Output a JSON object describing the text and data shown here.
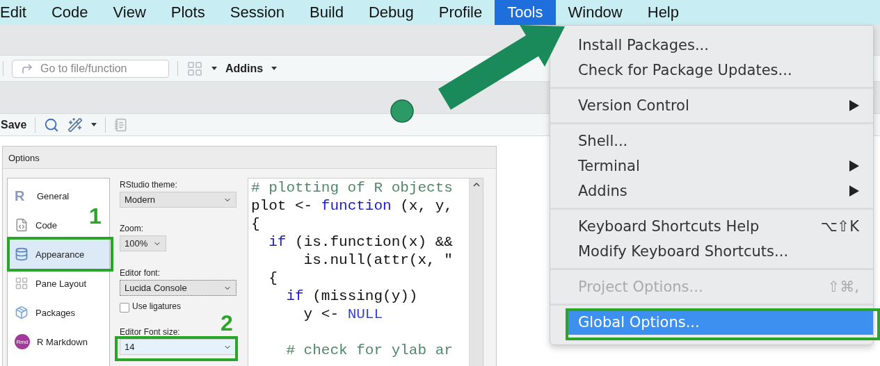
{
  "menubar": {
    "items": [
      {
        "label": "Edit",
        "selected": false
      },
      {
        "label": "Code",
        "selected": false
      },
      {
        "label": "View",
        "selected": false
      },
      {
        "label": "Plots",
        "selected": false
      },
      {
        "label": "Session",
        "selected": false
      },
      {
        "label": "Build",
        "selected": false
      },
      {
        "label": "Debug",
        "selected": false
      },
      {
        "label": "Profile",
        "selected": false
      },
      {
        "label": "Tools",
        "selected": true
      },
      {
        "label": "Window",
        "selected": false
      },
      {
        "label": "Help",
        "selected": false
      }
    ]
  },
  "toolbar": {
    "search_placeholder": "Go to file/function",
    "addins": "Addins"
  },
  "editor_toolbar": {
    "save": "Save"
  },
  "dialog": {
    "title": "Options",
    "sidebar": [
      {
        "label": "General",
        "selected": false,
        "icon_text": "R"
      },
      {
        "label": "Code",
        "selected": false
      },
      {
        "label": "Appearance",
        "selected": true
      },
      {
        "label": "Pane Layout",
        "selected": false
      },
      {
        "label": "Packages",
        "selected": false
      },
      {
        "label": "R Markdown",
        "selected": false,
        "icon_text": "Rmd"
      }
    ],
    "settings": {
      "theme_label": "RStudio theme:",
      "theme": "Modern",
      "zoom_label": "Zoom:",
      "zoom": "100%",
      "font_label": "Editor font:",
      "font": "Lucida Console",
      "ligatures_label": "Use ligatures",
      "ligatures": false,
      "size_label": "Editor Font size:",
      "size": "14"
    },
    "code": [
      {
        "blank_before": false,
        "tokens": [
          {
            "kind": "comment",
            "text": "# plotting of R objects"
          }
        ]
      },
      {
        "blank_before": false,
        "tokens": [
          {
            "kind": "plain",
            "text": "plot <- "
          },
          {
            "kind": "keyword",
            "text": "function"
          },
          {
            "kind": "plain",
            "text": " (x, y,"
          }
        ]
      },
      {
        "blank_before": false,
        "tokens": [
          {
            "kind": "plain",
            "text": "{"
          }
        ]
      },
      {
        "blank_before": false,
        "tokens": [
          {
            "kind": "keyword",
            "text": "  if"
          },
          {
            "kind": "plain",
            "text": " (is.function(x) &&"
          }
        ]
      },
      {
        "blank_before": false,
        "tokens": [
          {
            "kind": "plain",
            "text": "      is.null(attr(x, \""
          }
        ]
      },
      {
        "blank_before": false,
        "tokens": [
          {
            "kind": "plain",
            "text": "  {"
          }
        ]
      },
      {
        "blank_before": false,
        "tokens": [
          {
            "kind": "keyword",
            "text": "    if"
          },
          {
            "kind": "plain",
            "text": " (missing(y))"
          }
        ]
      },
      {
        "blank_before": false,
        "tokens": [
          {
            "kind": "plain",
            "text": "      y <- "
          },
          {
            "kind": "constant",
            "text": "NULL"
          }
        ]
      },
      {
        "blank_before": true,
        "tokens": [
          {
            "kind": "comment",
            "text": "    # check for ylab ar"
          }
        ]
      }
    ]
  },
  "annotations": [
    {
      "label": "1"
    },
    {
      "label": "2"
    }
  ],
  "tools_menu": {
    "groups": [
      [
        {
          "label": "Install Packages...",
          "submenu": false,
          "disabled": false,
          "selected": false
        },
        {
          "label": "Check for Package Updates...",
          "submenu": false,
          "disabled": false,
          "selected": false
        }
      ],
      [
        {
          "label": "Version Control",
          "submenu": true,
          "disabled": false,
          "selected": false
        }
      ],
      [
        {
          "label": "Shell...",
          "submenu": false,
          "disabled": false,
          "selected": false
        },
        {
          "label": "Terminal",
          "submenu": true,
          "disabled": false,
          "selected": false
        },
        {
          "label": "Addins",
          "submenu": true,
          "disabled": false,
          "selected": false
        }
      ],
      [
        {
          "label": "Keyboard Shortcuts Help",
          "shortcut": "⌥⇧K",
          "submenu": false,
          "disabled": false,
          "selected": false
        },
        {
          "label": "Modify Keyboard Shortcuts...",
          "submenu": false,
          "disabled": false,
          "selected": false
        }
      ],
      [
        {
          "label": "Project Options...",
          "shortcut": "⇧⌘,",
          "submenu": false,
          "disabled": true,
          "selected": false
        }
      ],
      [
        {
          "label": "Global Options...",
          "submenu": false,
          "disabled": false,
          "selected": true
        }
      ]
    ]
  }
}
